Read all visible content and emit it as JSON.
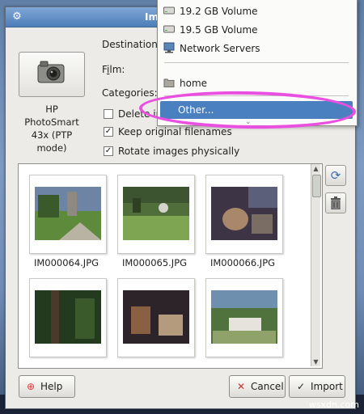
{
  "window": {
    "title": "Im",
    "icon": "window-menu-icon",
    "close": "✕"
  },
  "camera": {
    "name_lines": [
      "HP",
      "PhotoSmart",
      "43x (PTP",
      "mode)"
    ],
    "icon": "camera-icon"
  },
  "form": {
    "destination_label": "Destination:",
    "film_label_pre": "F",
    "film_label_u": "i",
    "film_label_post": "lm:",
    "categories_label": "Categories:"
  },
  "options": [
    {
      "label": "Delete im",
      "checked": false
    },
    {
      "label": "Keep original filenames",
      "checked": true
    },
    {
      "label": "Rotate images physically",
      "checked": true
    }
  ],
  "thumbnails": [
    {
      "name": "IM000064.JPG"
    },
    {
      "name": "IM000065.JPG"
    },
    {
      "name": "IM000066.JPG"
    },
    {
      "name": ""
    },
    {
      "name": ""
    },
    {
      "name": ""
    }
  ],
  "side_buttons": [
    {
      "icon": "refresh-icon"
    },
    {
      "icon": "trash-icon"
    }
  ],
  "buttons": {
    "help": "Help",
    "cancel": "Cancel",
    "import": "Import"
  },
  "dropdown": {
    "items": [
      {
        "label": "19.2 GB Volume",
        "icon": "drive-icon"
      },
      {
        "label": "19.5 GB Volume",
        "icon": "drive-icon"
      },
      {
        "label": "Network Servers",
        "icon": "network-icon"
      },
      {
        "label": "home",
        "icon": "folder-icon"
      },
      {
        "label": "Other...",
        "icon": ""
      }
    ],
    "more_indicator": "⌄"
  },
  "annotation_color": "#e94fe0",
  "selection_color": "#4a7fc0",
  "watermark": "wsxdn.com"
}
